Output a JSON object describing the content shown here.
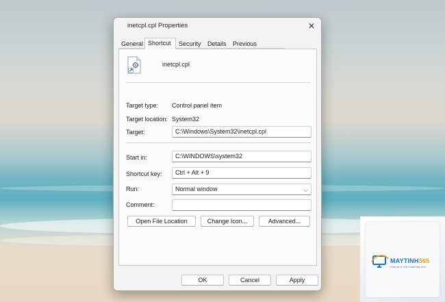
{
  "window": {
    "title": "inetcpl.cpl Properties"
  },
  "tabs": [
    {
      "label": "General"
    },
    {
      "label": "Shortcut"
    },
    {
      "label": "Security"
    },
    {
      "label": "Details"
    },
    {
      "label": "Previous Versions"
    }
  ],
  "shortcut": {
    "file_name": "inetcpl.cpl",
    "target_type_label": "Target type:",
    "target_type_value": "Control panel item",
    "target_location_label": "Target location:",
    "target_location_value": "System32",
    "target_label": "Target:",
    "target_value": "C:\\Windows\\System32\\inetcpl.cpl",
    "start_in_label": "Start in:",
    "start_in_value": "C:\\WINDOWS\\system32",
    "shortcut_key_label": "Shortcut key:",
    "shortcut_key_value": "Ctrl + Alt + 9",
    "run_label": "Run:",
    "run_value": "Normal window",
    "comment_label": "Comment:",
    "comment_value": "",
    "open_file_location": "Open File Location",
    "change_icon": "Change Icon...",
    "advanced": "Advanced..."
  },
  "footer": {
    "ok": "OK",
    "cancel": "Cancel",
    "apply": "Apply"
  },
  "watermark": {
    "brand_main": "MAYTINH",
    "brand_num": "365",
    "tagline": "Chia sẻ & Thủ thuật Máy tính"
  },
  "icons": {
    "close": "close-icon",
    "dropdown": "chevron-down-icon",
    "file": "shortcut-file-icon"
  }
}
